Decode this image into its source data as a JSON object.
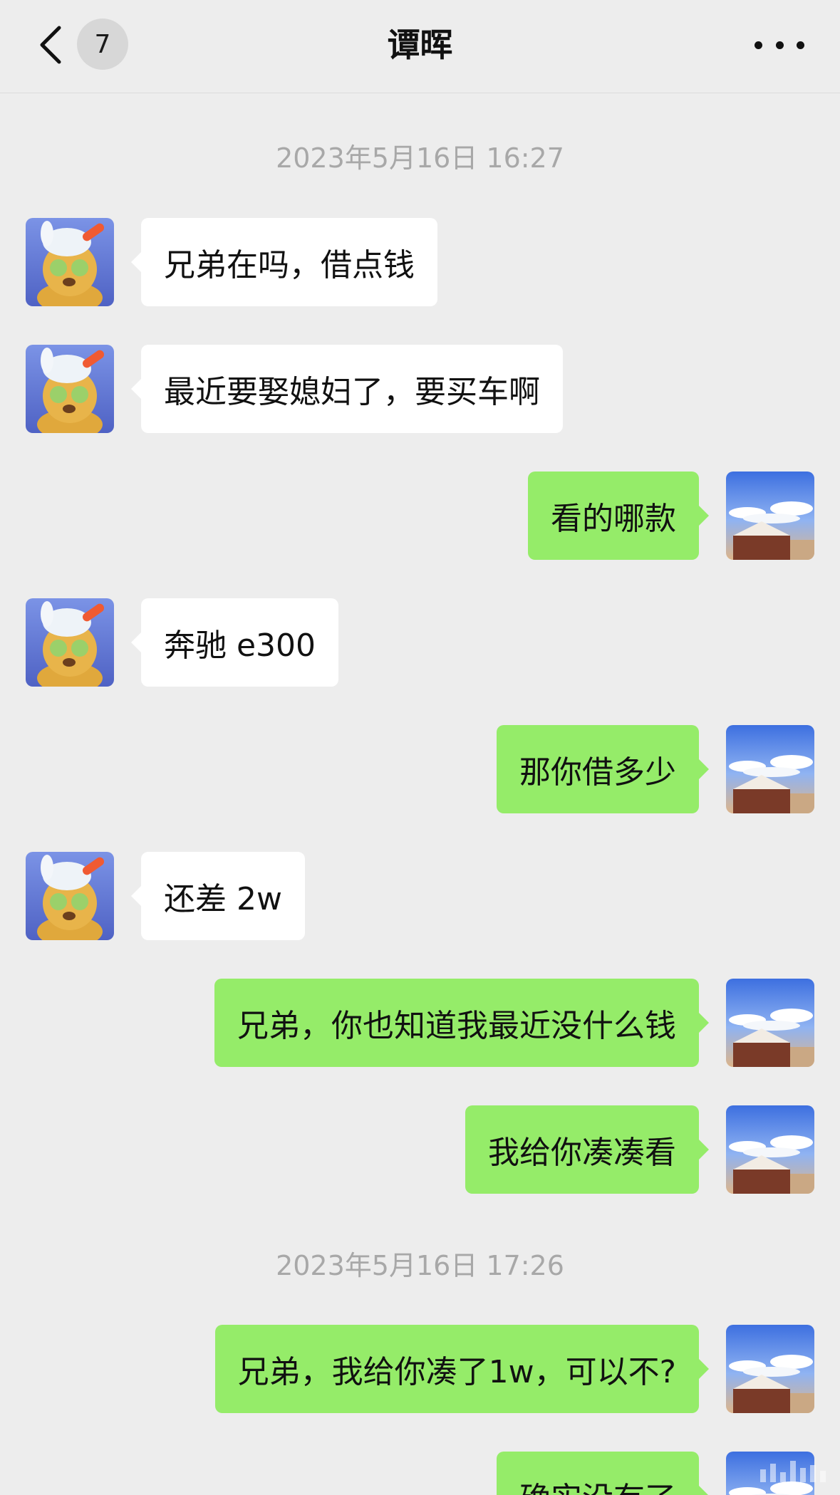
{
  "header": {
    "title": "谭晖",
    "unread_count": "7"
  },
  "timestamps": [
    "2023年5月16日 16:27",
    "2023年5月16日 17:26"
  ],
  "messages": [
    {
      "side": "in",
      "text": "兄弟在吗，借点钱"
    },
    {
      "side": "in",
      "text": "最近要娶媳妇了，要买车啊"
    },
    {
      "side": "out",
      "text": "看的哪款"
    },
    {
      "side": "in",
      "text": "奔驰 e300"
    },
    {
      "side": "out",
      "text": "那你借多少"
    },
    {
      "side": "in",
      "text": "还差 2w"
    },
    {
      "side": "out",
      "text": "兄弟，你也知道我最近没什么钱"
    },
    {
      "side": "out",
      "text": "我给你凑凑看"
    },
    {
      "side": "out",
      "text": "兄弟，我给你凑了1w，可以不?"
    },
    {
      "side": "out",
      "text": "确实没有了"
    }
  ],
  "icons": {
    "back": "chevron-left-icon",
    "more": "more-dots-icon",
    "contact_avatar": "bear-avatar",
    "self_avatar": "landscape-avatar"
  },
  "colors": {
    "background": "#ededed",
    "incoming_bubble": "#ffffff",
    "outgoing_bubble": "#95ec69",
    "timestamp_text": "#a8a8a8"
  }
}
